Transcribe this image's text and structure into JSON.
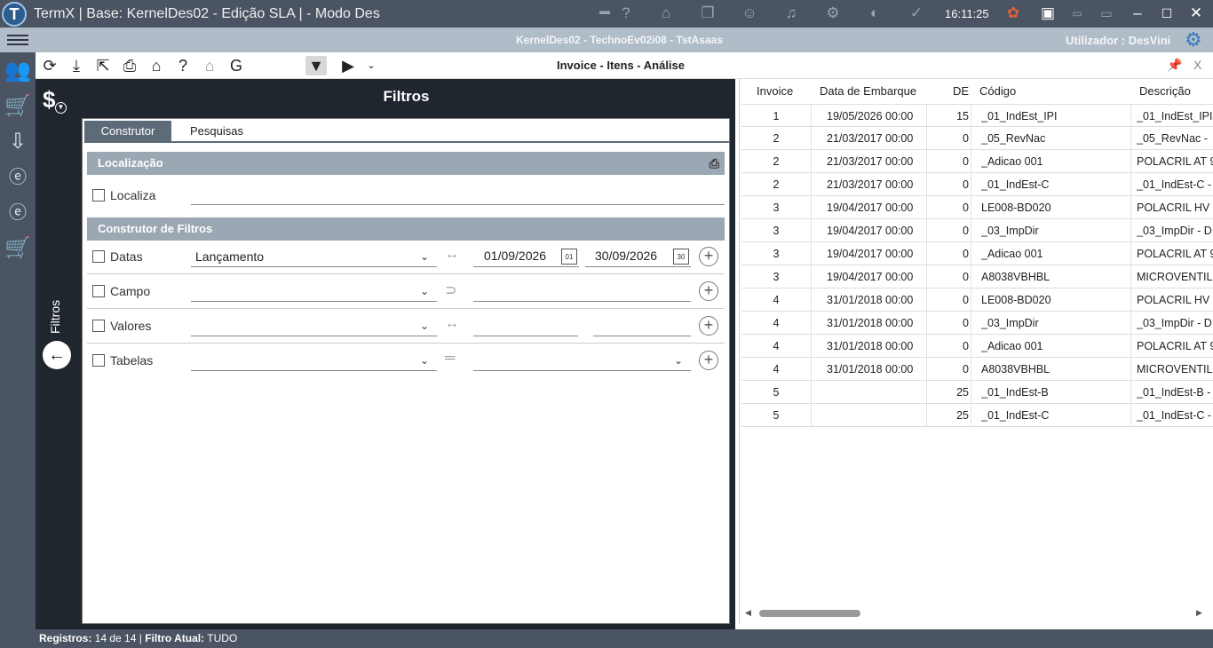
{
  "window": {
    "title": "TermX | Base: KernelDes02 - Edição SLA | - Modo Des",
    "clock": "16:11:25"
  },
  "subbar": {
    "center": "KernelDes02 - TechnoEv02i08 - TstAsaas",
    "user_label": "Utilizador :",
    "user_name": "DesVini"
  },
  "toolbar": {
    "view_title": "Invoice - Itens - Análise",
    "close_label": "X"
  },
  "filters": {
    "header": "Filtros",
    "side_label": "Filtros",
    "tabs": [
      "Construtor",
      "Pesquisas"
    ],
    "section_location": "Localização",
    "localiza_label": "Localiza",
    "section_builder": "Construtor de Filtros",
    "datas_label": "Datas",
    "datas_value": "Lançamento",
    "date_from": "01/09/2026",
    "date_to": "30/09/2026",
    "cal_from": "01",
    "cal_to": "30",
    "campo_label": "Campo",
    "valores_label": "Valores",
    "tabelas_label": "Tabelas"
  },
  "grid": {
    "columns": [
      "Invoice",
      "Data de Embarque",
      "DE",
      "Código",
      "Descrição"
    ],
    "rows": [
      [
        "1",
        "19/05/2026 00:00",
        "15",
        "_01_IndEst_IPI",
        "_01_IndEst_IPI"
      ],
      [
        "2",
        "21/03/2017 00:00",
        "0",
        "_05_RevNac",
        "_05_RevNac -"
      ],
      [
        "2",
        "21/03/2017 00:00",
        "0",
        "_Adicao 001",
        "POLACRIL AT 9"
      ],
      [
        "2",
        "21/03/2017 00:00",
        "0",
        "_01_IndEst-C",
        "_01_IndEst-C -"
      ],
      [
        "3",
        "19/04/2017 00:00",
        "0",
        "LE008-BD020",
        "POLACRIL HV"
      ],
      [
        "3",
        "19/04/2017 00:00",
        "0",
        "_03_ImpDir",
        "_03_ImpDir - D"
      ],
      [
        "3",
        "19/04/2017 00:00",
        "0",
        "_Adicao 001",
        "POLACRIL AT 9"
      ],
      [
        "3",
        "19/04/2017 00:00",
        "0",
        "A8038VBHBL",
        "MICROVENTIL"
      ],
      [
        "4",
        "31/01/2018 00:00",
        "0",
        "LE008-BD020",
        "POLACRIL HV"
      ],
      [
        "4",
        "31/01/2018 00:00",
        "0",
        "_03_ImpDir",
        "_03_ImpDir - D"
      ],
      [
        "4",
        "31/01/2018 00:00",
        "0",
        "_Adicao 001",
        "POLACRIL AT 9"
      ],
      [
        "4",
        "31/01/2018 00:00",
        "0",
        "A8038VBHBL",
        "MICROVENTIL"
      ],
      [
        "5",
        "",
        "25",
        "_01_IndEst-B",
        "_01_IndEst-B -"
      ],
      [
        "5",
        "",
        "25",
        "_01_IndEst-C",
        "_01_IndEst-C -"
      ]
    ]
  },
  "status": {
    "records_label": "Registros:",
    "records_value": "14 de 14",
    "sep": "|",
    "filter_label": "Filtro Atual:",
    "filter_value": "TUDO"
  }
}
